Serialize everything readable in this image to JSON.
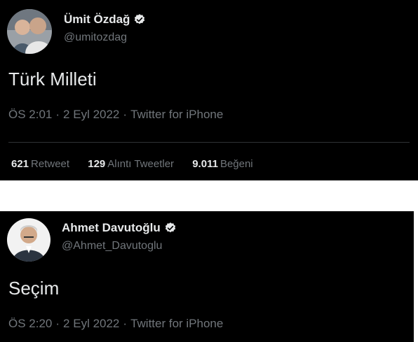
{
  "tweets": [
    {
      "name": "Ümit Özdağ",
      "handle": "@umitozdag",
      "text": "Türk Milleti",
      "time": "ÖS 2:01",
      "date": "2 Eyl 2022",
      "source": "Twitter for iPhone",
      "stats": [
        {
          "value": "621",
          "label": "Retweet"
        },
        {
          "value": "129",
          "label": "Alıntı Tweetler"
        },
        {
          "value": "9.011",
          "label": "Beğeni"
        }
      ]
    },
    {
      "name": "Ahmet Davutoğlu",
      "handle": "@Ahmet_Davutoglu",
      "text": "Seçim",
      "time": "ÖS 2:20",
      "date": "2 Eyl 2022",
      "source": "Twitter for iPhone"
    }
  ],
  "separator": "·",
  "colors": {
    "background": "#000000",
    "primary_text": "#e7e9ea",
    "secondary_text": "#71767b",
    "verified_badge": "#e7e9ea"
  }
}
